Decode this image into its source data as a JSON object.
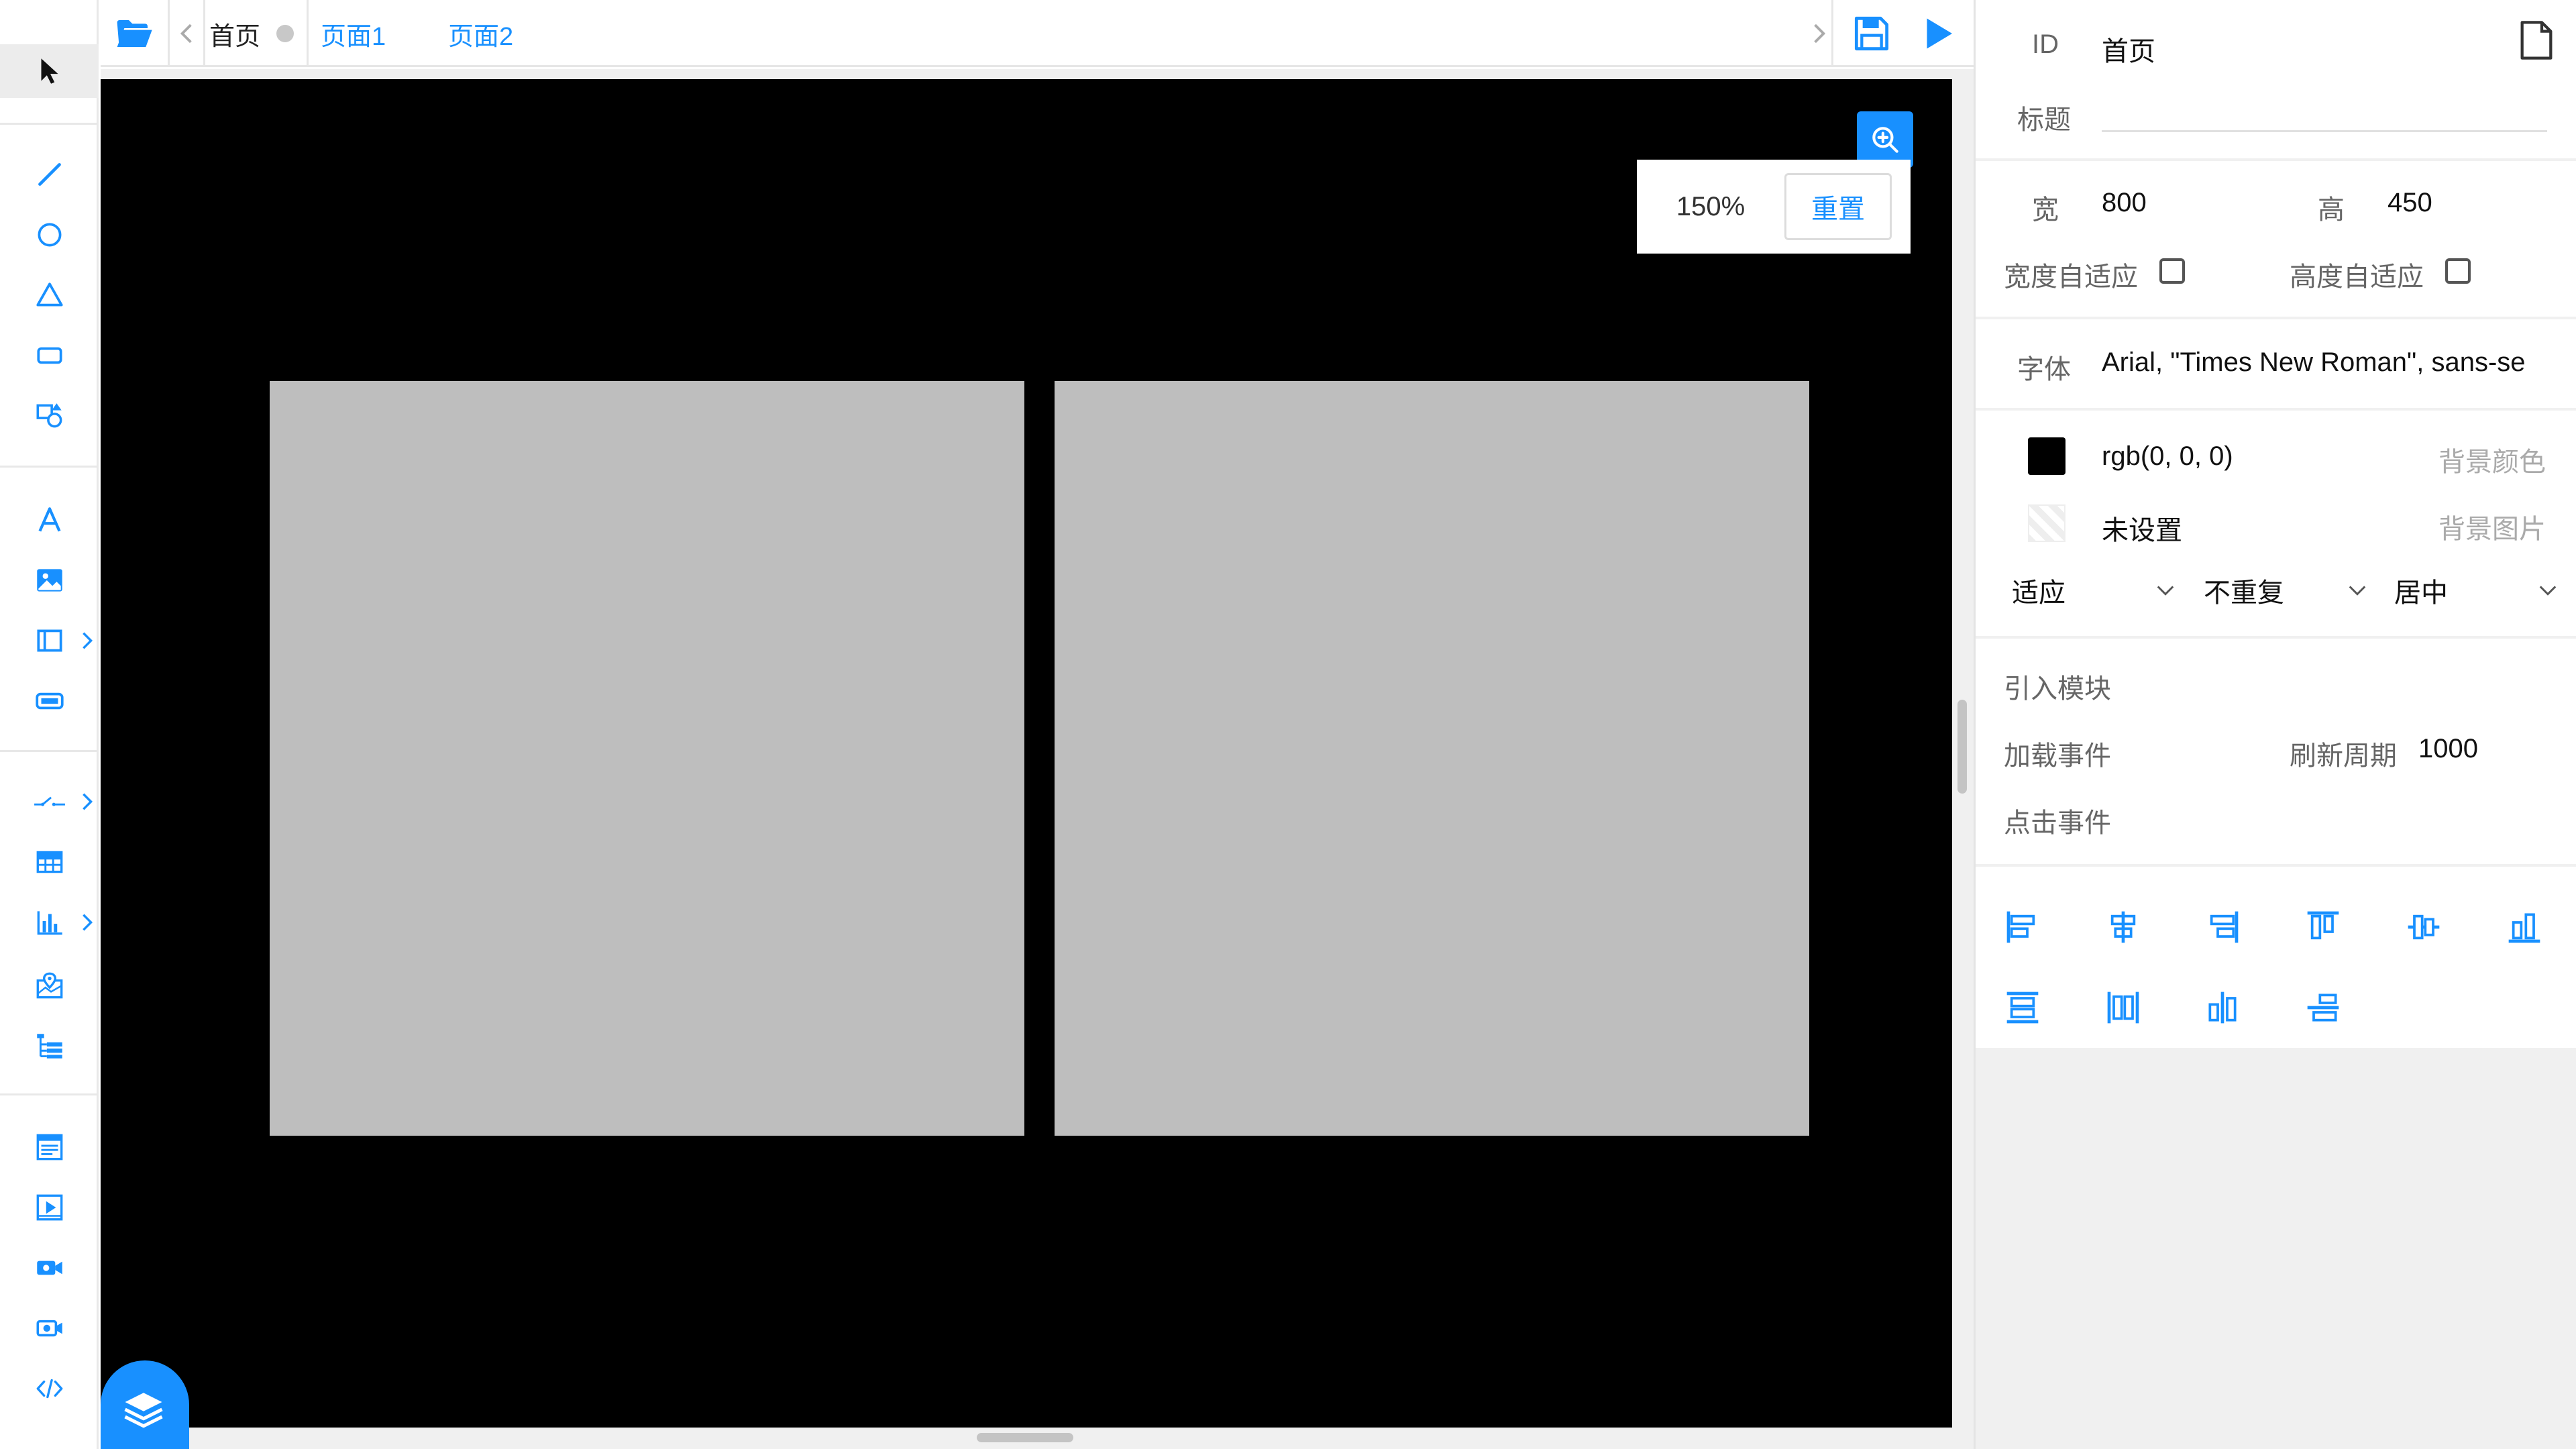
{
  "colors": {
    "accent": "#1890ff",
    "canvas_bg": "#000000",
    "panel_fill": "#bebebe"
  },
  "toolbar": {
    "tools": [
      {
        "name": "pointer-tool",
        "icon": "cursor-arrow-icon"
      },
      {
        "name": "line-tool",
        "icon": "line-icon"
      },
      {
        "name": "circle-tool",
        "icon": "circle-icon"
      },
      {
        "name": "triangle-tool",
        "icon": "triangle-icon"
      },
      {
        "name": "rectangle-tool",
        "icon": "rectangle-icon"
      },
      {
        "name": "shapes-tool",
        "icon": "shapes-icon"
      },
      {
        "name": "text-tool",
        "icon": "text-icon"
      },
      {
        "name": "image-tool",
        "icon": "image-icon"
      },
      {
        "name": "frame-tool",
        "icon": "frame-icon"
      },
      {
        "name": "button-tool",
        "icon": "button-icon"
      },
      {
        "name": "switch-tool",
        "icon": "switch-icon"
      },
      {
        "name": "table-tool",
        "icon": "table-icon"
      },
      {
        "name": "chart-tool",
        "icon": "bar-chart-icon"
      },
      {
        "name": "map-tool",
        "icon": "map-icon"
      },
      {
        "name": "tree-tool",
        "icon": "tree-list-icon"
      },
      {
        "name": "webpage-tool",
        "icon": "webpage-icon"
      },
      {
        "name": "video-tool",
        "icon": "video-icon"
      },
      {
        "name": "camera-tool",
        "icon": "camera-icon"
      },
      {
        "name": "live-tool",
        "icon": "live-camera-icon"
      },
      {
        "name": "code-tool",
        "icon": "code-icon"
      }
    ]
  },
  "tabs": {
    "home": "首页",
    "page1": "页面1",
    "page2": "页面2"
  },
  "canvas": {
    "zoom_level": "150%",
    "reset_label": "重置"
  },
  "props": {
    "id_label": "ID",
    "id_value": "首页",
    "title_label": "标题",
    "title_value": "",
    "width_label": "宽",
    "width_value": "800",
    "height_label": "高",
    "height_value": "450",
    "auto_width_label": "宽度自适应",
    "auto_height_label": "高度自适应",
    "font_label": "字体",
    "font_value": "Arial, \"Times New Roman\", sans-se",
    "bg_color_value": "rgb(0, 0, 0)",
    "bg_color_label": "背景颜色",
    "bg_image_value": "未设置",
    "bg_image_label": "背景图片",
    "fit_value": "适应",
    "repeat_value": "不重复",
    "position_value": "居中",
    "import_module_label": "引入模块",
    "load_event_label": "加载事件",
    "refresh_period_label": "刷新周期",
    "refresh_period_value": "1000",
    "click_event_label": "点击事件"
  }
}
